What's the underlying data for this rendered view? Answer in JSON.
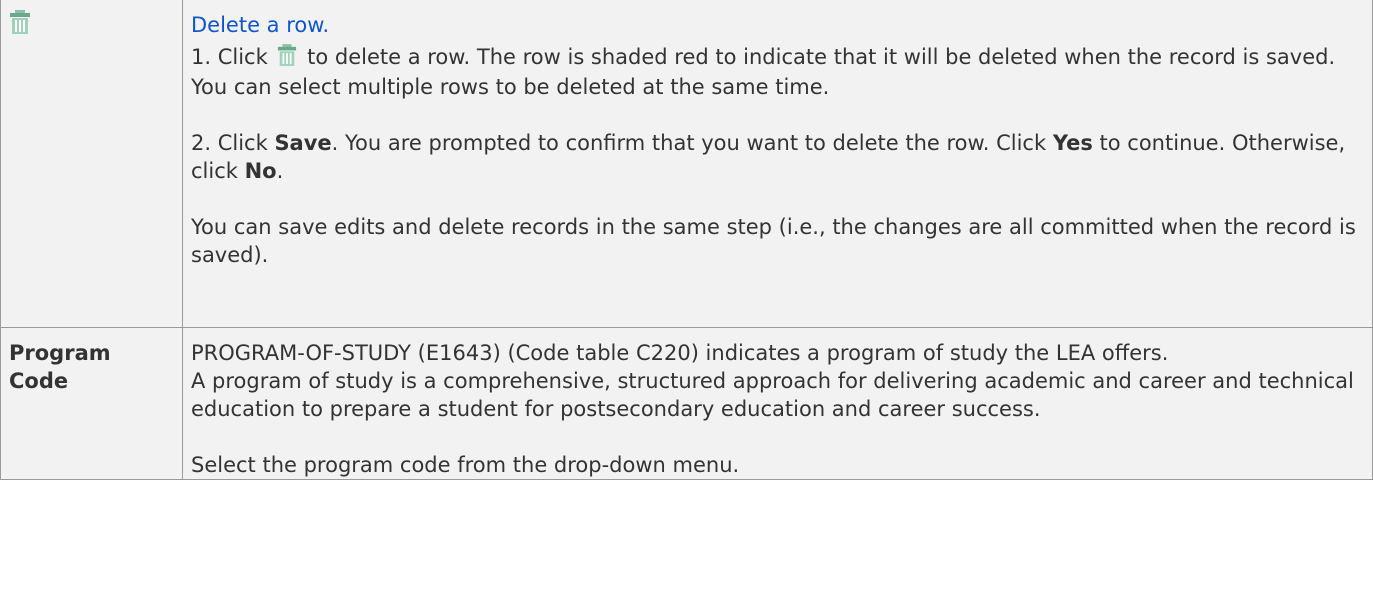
{
  "rows": [
    {
      "icon": "trash-icon",
      "title": "Delete a row.",
      "step1_before": "1. Click",
      "step1_after": " to delete a row. The row is shaded red to indicate that it will be deleted when the record is saved. You can select multiple rows to be deleted at the same time.",
      "step2_a": "2. Click ",
      "step2_save": "Save",
      "step2_b": ". You are prompted to confirm that you want to delete the row. Click ",
      "step2_yes": "Yes",
      "step2_c": " to continue. Otherwise, click ",
      "step2_no": "No",
      "step2_d": ".",
      "note": "You can save edits and delete records in the same step (i.e., the changes are all committed when the record is saved)."
    },
    {
      "label": "Program Code",
      "desc1": "PROGRAM-OF-STUDY (E1643) (Code table C220) indicates a program of study the LEA offers.",
      "desc2": "A program of study is a comprehensive, structured approach for delivering academic and career and technical education to prepare a student for postsecondary education and career success.",
      "desc3": "Select the program code from the drop-down menu."
    }
  ],
  "colors": {
    "icon": "#6aaa8a",
    "link": "#1155cc",
    "cell_bg": "#f2f2f2",
    "border": "#9a9a9a"
  }
}
